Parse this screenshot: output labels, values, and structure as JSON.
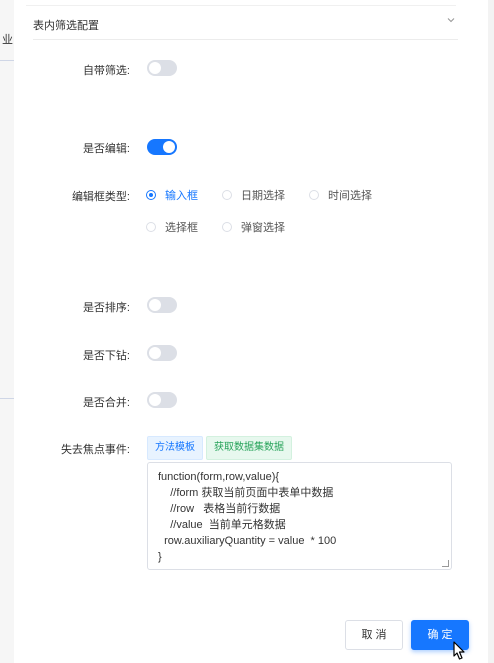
{
  "background": {
    "left_fragment": "业"
  },
  "section": {
    "title": "表内筛选配置"
  },
  "fields": {
    "builtin_filter": {
      "label": "自带筛选:",
      "on": false
    },
    "editable": {
      "label": "是否编辑:",
      "on": true
    },
    "editor_type": {
      "label": "编辑框类型:",
      "options": [
        "输入框",
        "日期选择",
        "时间选择",
        "选择框",
        "弹窗选择"
      ],
      "selected": "输入框"
    },
    "sortable": {
      "label": "是否排序:",
      "on": false
    },
    "drilldown": {
      "label": "是否下钻:",
      "on": false
    },
    "mergeable": {
      "label": "是否合并:",
      "on": false
    },
    "blur_event": {
      "label": "失去焦点事件:",
      "tags": [
        "方法模板",
        "获取数据集数据"
      ],
      "code_lines": [
        "function(form,row,value){",
        "    //form 获取当前页面中表单中数据",
        "    //row   表格当前行数据",
        "    //value  当前单元格数据",
        "  row.auxiliaryQuantity = value  * 100",
        "}"
      ]
    }
  },
  "footer": {
    "cancel": "取 消",
    "confirm": "确 定"
  },
  "colors": {
    "primary": "#1677ff",
    "success": "#27a35a",
    "switch_off": "#dcdfe6"
  }
}
